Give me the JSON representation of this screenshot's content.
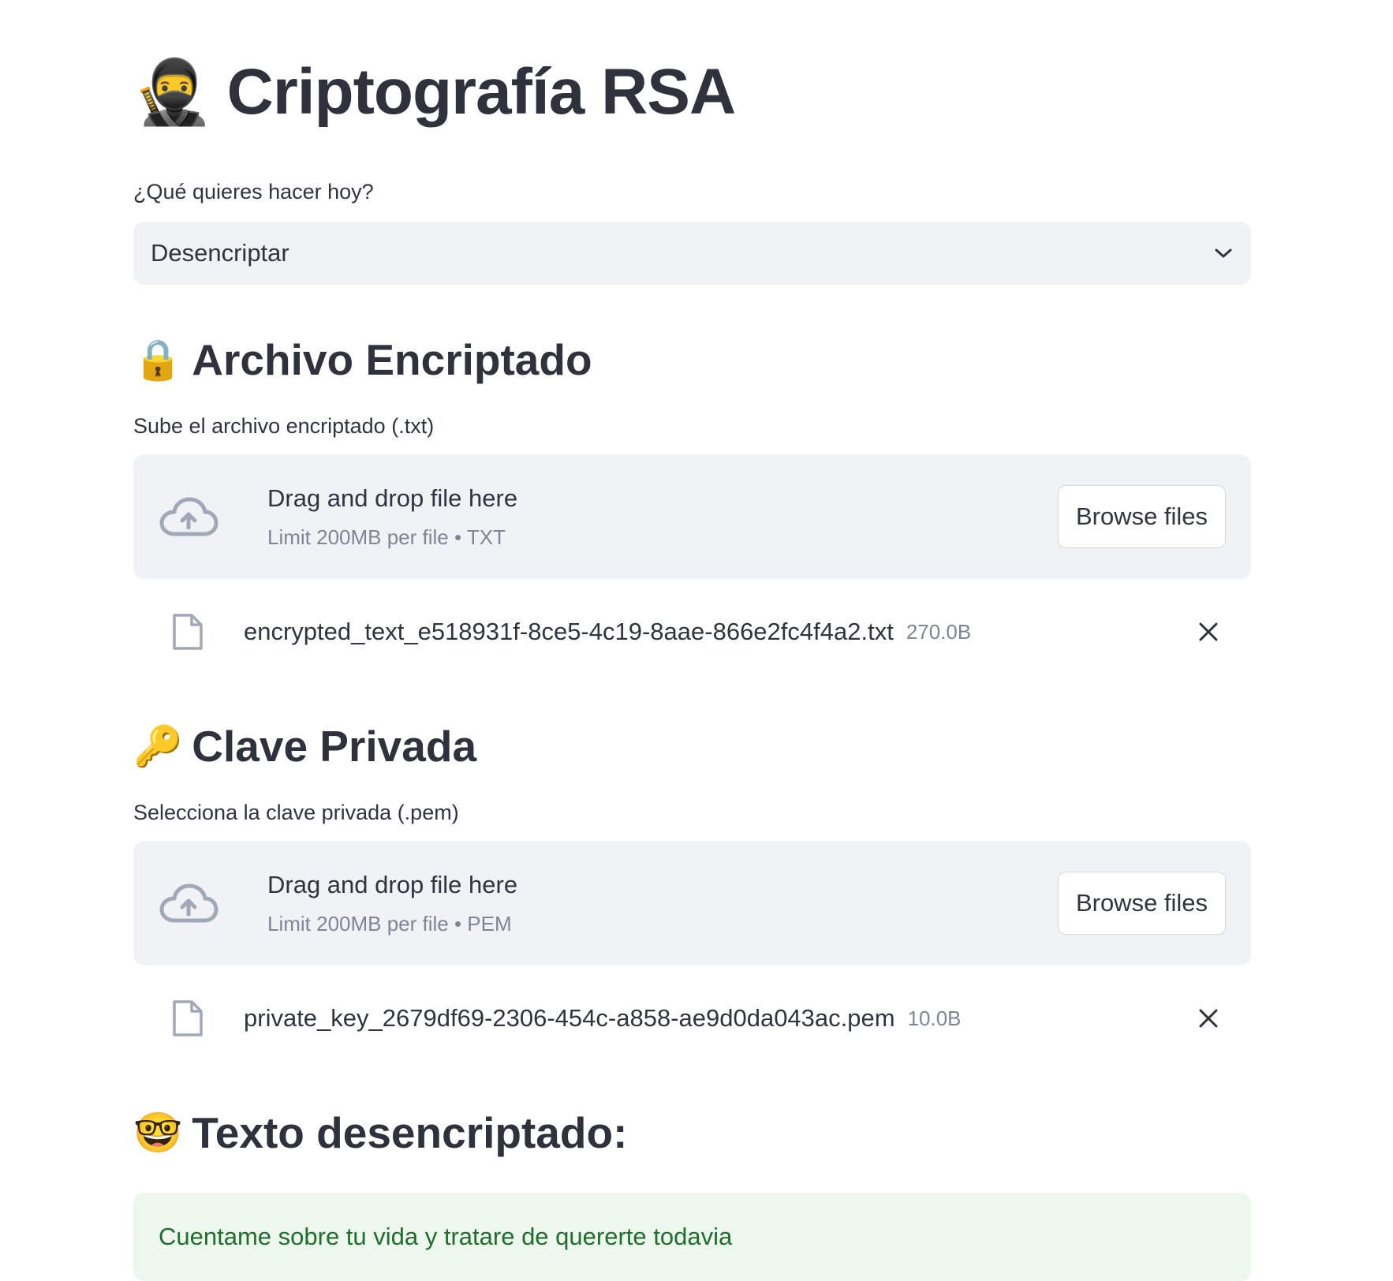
{
  "header": {
    "emoji": "🥷",
    "title": "Criptografía RSA"
  },
  "action_select": {
    "label": "¿Qué quieres hacer hoy?",
    "selected": "Desencriptar",
    "icon": "chevron-down-icon"
  },
  "encrypted_section": {
    "emoji": "🔒",
    "heading": "Archivo Encriptado",
    "uploader": {
      "label": "Sube el archivo encriptado (.txt)",
      "dropzone_title": "Drag and drop file here",
      "dropzone_limit": "Limit 200MB per file • TXT",
      "browse_label": "Browse files",
      "icon": "cloud-upload-icon"
    },
    "file": {
      "name": "encrypted_text_e518931f-8ce5-4c19-8aae-866e2fc4f4a2.txt",
      "size": "270.0B",
      "icon": "file-icon"
    }
  },
  "key_section": {
    "emoji": "🔑",
    "heading": "Clave Privada",
    "uploader": {
      "label": "Selecciona la clave privada (.pem)",
      "dropzone_title": "Drag and drop file here",
      "dropzone_limit": "Limit 200MB per file • PEM",
      "browse_label": "Browse files",
      "icon": "cloud-upload-icon"
    },
    "file": {
      "name": "private_key_2679df69-2306-454c-a858-ae9d0da043ac.pem",
      "size": "10.0B",
      "icon": "file-icon"
    }
  },
  "result_section": {
    "emoji": "🤓",
    "heading": "Texto desencriptado:",
    "message": "Cuentame sobre tu vida y tratare de quererte todavia"
  },
  "colors": {
    "widget_bg": "#f0f2f6",
    "text": "#31333f",
    "muted": "#808495",
    "success_bg": "#edf7ee",
    "success_text": "#1f6e2b"
  }
}
